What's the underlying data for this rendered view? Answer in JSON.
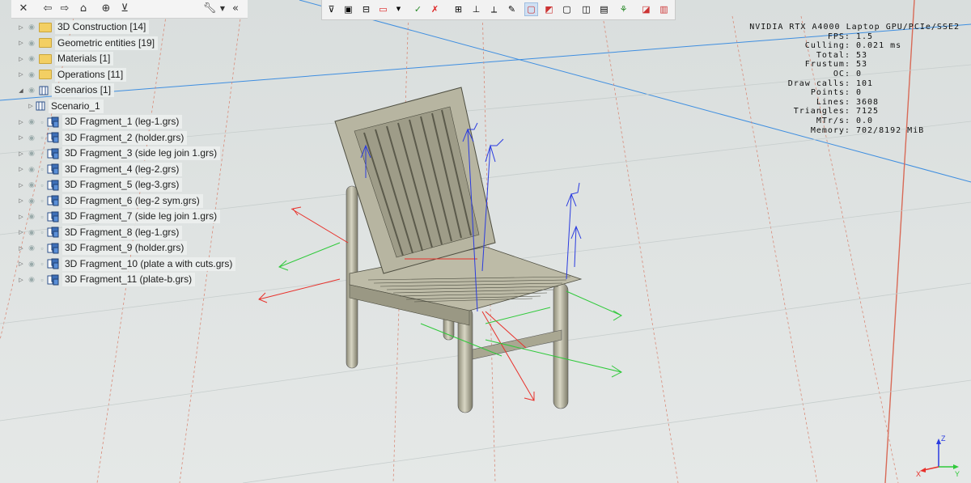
{
  "tree_toolbar": {
    "icons": [
      "close-icon",
      "arrow-left-icon",
      "arrow-right-icon",
      "home-icon",
      "target-icon",
      "dropdown-box-icon",
      "wrench-icon",
      "chevron-down-icon",
      "collapse-left-icon"
    ]
  },
  "tree": {
    "items": [
      {
        "label": "3D Construction [14]",
        "type": "folder"
      },
      {
        "label": "Geometric entities [19]",
        "type": "folder"
      },
      {
        "label": "Materials [1]",
        "type": "folder"
      },
      {
        "label": "Operations [11]",
        "type": "folder"
      },
      {
        "label": "Scenarios [1]",
        "type": "scenarios"
      },
      {
        "label": "Scenario_1",
        "type": "scenario"
      },
      {
        "label": "3D Fragment_1 (leg-1.grs)",
        "type": "fragment"
      },
      {
        "label": "3D Fragment_2 (holder.grs)",
        "type": "fragment"
      },
      {
        "label": "3D Fragment_3 (side leg join 1.grs)",
        "type": "fragment"
      },
      {
        "label": "3D Fragment_4 (leg-2.grs)",
        "type": "fragment"
      },
      {
        "label": "3D Fragment_5 (leg-3.grs)",
        "type": "fragment"
      },
      {
        "label": "3D Fragment_6 (leg-2 sym.grs)",
        "type": "fragment"
      },
      {
        "label": "3D Fragment_7 (side leg join 1.grs)",
        "type": "fragment"
      },
      {
        "label": "3D Fragment_8 (leg-1.grs)",
        "type": "fragment"
      },
      {
        "label": "3D Fragment_9 (holder.grs)",
        "type": "fragment"
      },
      {
        "label": "3D Fragment_10 (plate a with cuts.grs)",
        "type": "fragment"
      },
      {
        "label": "3D Fragment_11 (plate-b.grs)",
        "type": "fragment"
      }
    ]
  },
  "top_toolbar": {
    "icons": [
      "filter-icon",
      "filter-box-icon",
      "layers-filter-icon",
      "select-rect-icon",
      "dropdown-icon",
      "check-vector-icon",
      "cross-vector-icon",
      "grid-icon",
      "axes-icon",
      "axes-3d-icon",
      "pen-icon",
      "cube-wire-icon",
      "cube-shaded-icon",
      "cube-edges-icon",
      "cube-outline-icon",
      "cube-solid-icon",
      "shapes-icon",
      "cube-red-icon",
      "panel-icon"
    ],
    "active_icon": "cube-wire-icon"
  },
  "stats": {
    "gpu": "NVIDIA RTX A4000 Laptop GPU/PCIe/SSE2",
    "rows": [
      {
        "label": "FPS:",
        "value": "1.5"
      },
      {
        "label": "Culling:",
        "value": "0.021 ms"
      },
      {
        "label": "Total:",
        "value": "53"
      },
      {
        "label": "Frustum:",
        "value": "53"
      },
      {
        "label": "OC:",
        "value": "0"
      },
      {
        "label": "Draw calls:",
        "value": "101"
      },
      {
        "label": "Points:",
        "value": "0"
      },
      {
        "label": "Lines:",
        "value": "3608"
      },
      {
        "label": "Triangles:",
        "value": "7125"
      },
      {
        "label": "MTr/s:",
        "value": "0.0"
      },
      {
        "label": "Memory:",
        "value": "702/8192 MiB"
      }
    ]
  },
  "axis_labels": {
    "x": "X",
    "y": "Y",
    "z": "Z"
  },
  "colors": {
    "axis_x": "#e8302a",
    "axis_y": "#2fc93a",
    "axis_z": "#2a3be0",
    "chair": "#b3b19d",
    "grid_line": "#d86a57",
    "horizon": "#3e8ee0"
  }
}
